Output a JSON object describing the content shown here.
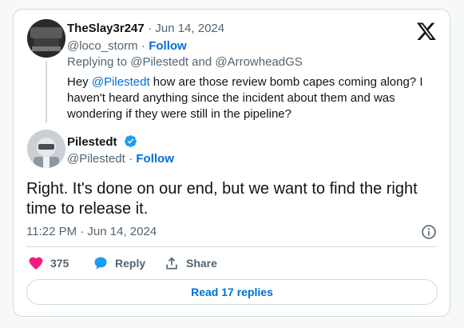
{
  "reply_tweet": {
    "author_name": "TheSlay3r247",
    "date": "Jun 14, 2024",
    "handle": "@loco_storm",
    "follow_label": "Follow",
    "replying_to_prefix": "Replying to",
    "replying_to_1": "@Pilestedt",
    "replying_to_and": "and",
    "replying_to_2": "@ArrowheadGS",
    "text_mention": "@Pilestedt",
    "text": "how are those review bomb capes coming along? I haven't heard anything since the incident about them and was wondering if they were still in the pipeline?",
    "text_prefix": "Hey"
  },
  "main_tweet": {
    "author_name": "Pilestedt",
    "handle": "@Pilestedt",
    "follow_label": "Follow",
    "text": "Right. It's done on our end, but we want to find the right time to release it.",
    "timestamp": "11:22 PM · Jun 14, 2024"
  },
  "actions": {
    "like_count": "375",
    "reply_label": "Reply",
    "share_label": "Share"
  },
  "read_replies_label": "Read 17 replies",
  "colors": {
    "accent": "#006fd6",
    "like": "#f91880",
    "muted": "#536471",
    "border": "#cfd9de",
    "verified": "#1d9bf0"
  },
  "icons": {
    "logo": "x-logo-icon",
    "verified": "verified-badge-icon",
    "like": "heart-icon",
    "reply": "reply-bubble-icon",
    "share": "share-icon",
    "info": "info-icon"
  }
}
